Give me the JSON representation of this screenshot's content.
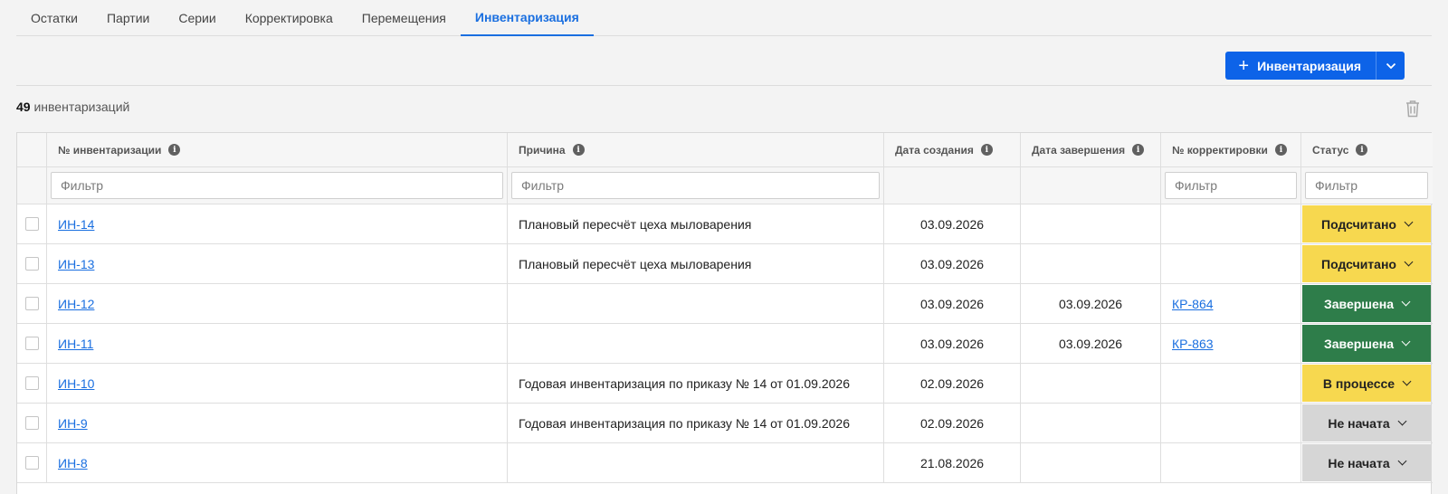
{
  "tabs": [
    {
      "label": "Остатки"
    },
    {
      "label": "Партии"
    },
    {
      "label": "Серии"
    },
    {
      "label": "Корректировка"
    },
    {
      "label": "Перемещения"
    },
    {
      "label": "Инвентаризация",
      "active": true
    }
  ],
  "toolbar": {
    "create_label": "Инвентаризация",
    "create_icon": "plus-icon",
    "dropdown_icon": "chevron-down-icon"
  },
  "summary": {
    "count": "49",
    "count_text": "инвентаризаций",
    "delete_icon": "trash-icon"
  },
  "table": {
    "columns": [
      {
        "label": "№ инвентаризации",
        "info": "i"
      },
      {
        "label": "Причина",
        "info": "i"
      },
      {
        "label": "Дата создания",
        "info": "i"
      },
      {
        "label": "Дата завершения",
        "info": "i"
      },
      {
        "label": "№ корректировки",
        "info": "i"
      },
      {
        "label": "Статус",
        "info": "i"
      }
    ],
    "filter_placeholder": "Фильтр",
    "rows": [
      {
        "number": "ИН-14",
        "reason": "Плановый пересчёт цеха мыловарения",
        "created": "03.09.2026",
        "completed": "",
        "correction": "",
        "status": "Подсчитано"
      },
      {
        "number": "ИН-13",
        "reason": "Плановый пересчёт цеха мыловарения",
        "created": "03.09.2026",
        "completed": "",
        "correction": "",
        "status": "Подсчитано"
      },
      {
        "number": "ИН-12",
        "reason": "",
        "created": "03.09.2026",
        "completed": "03.09.2026",
        "correction": "КР-864",
        "status": "Завершена"
      },
      {
        "number": "ИН-11",
        "reason": "",
        "created": "03.09.2026",
        "completed": "03.09.2026",
        "correction": "КР-863",
        "status": "Завершена"
      },
      {
        "number": "ИН-10",
        "reason": "Годовая инвентаризация по приказу № 14 от 01.09.2026",
        "created": "02.09.2026",
        "completed": "",
        "correction": "",
        "status": "В процессе"
      },
      {
        "number": "ИН-9",
        "reason": "Годовая инвентаризация по приказу № 14 от 01.09.2026",
        "created": "02.09.2026",
        "completed": "",
        "correction": "",
        "status": "Не начата"
      },
      {
        "number": "ИН-8",
        "reason": "",
        "created": "21.08.2026",
        "completed": "",
        "correction": "",
        "status": "Не начата"
      }
    ]
  },
  "status_colors": {
    "Подсчитано": "#f7d84f",
    "В процессе": "#f7d84f",
    "Завершена": "#2e7d4a",
    "Не начата": "#d6d6d6"
  }
}
